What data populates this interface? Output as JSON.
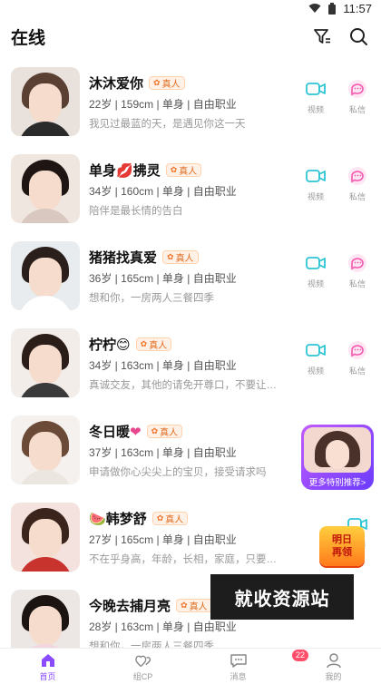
{
  "status": {
    "time": "11:57"
  },
  "header": {
    "title": "在线",
    "filter_icon": "filter-icon",
    "search_icon": "search-icon"
  },
  "ops": {
    "video_label": "视频",
    "chat_label": "私信"
  },
  "users": [
    {
      "name": "沐沐爱你",
      "badge": "真人",
      "meta": "22岁 | 159cm | 单身 | 自由职业",
      "sign": "我见过最蓝的天，是遇见你这一天",
      "emoji": ""
    },
    {
      "name": "单身",
      "emoji": "💋",
      "name2": "拂灵",
      "badge": "真人",
      "meta": "34岁 | 160cm | 单身 | 自由职业",
      "sign": "陪伴是最长情的告白"
    },
    {
      "name": "猪猪找真爱",
      "badge": "真人",
      "meta": "36岁 | 165cm | 单身 | 自由职业",
      "sign": "想和你，一房两人三餐四季",
      "emoji": ""
    },
    {
      "name": "柠柠",
      "emoji": "😊",
      "badge": "真人",
      "meta": "34岁 | 163cm | 单身 | 自由职业",
      "sign": "真诚交友，其他的请免开尊口，不要让你的..."
    },
    {
      "name": "冬日暖",
      "emoji": "❤",
      "badge": "真人",
      "meta": "37岁 | 163cm | 单身 | 自由职业",
      "sign": "申请做你心尖尖上的宝贝，接受请求吗"
    },
    {
      "name": "韩梦舒",
      "emoji": "🍉",
      "badge": "真人",
      "meta": "27岁 | 165cm | 单身 | 自由职业",
      "sign": "不在乎身高，年龄，长相，家庭，只要聊得..."
    },
    {
      "name": "今晚去捕月亮",
      "badge": "真人",
      "meta": "28岁 | 163cm | 单身 | 自由职业",
      "sign": "想和你，一房两人三餐四季",
      "emoji": ""
    }
  ],
  "promo": {
    "label": "更多特别推荐>"
  },
  "redeem": {
    "line1": "明日",
    "line2": "再领"
  },
  "watermark": "就收资源站",
  "tabbar": {
    "tabs": [
      {
        "label": "首页",
        "icon": "home-icon"
      },
      {
        "label": "组CP",
        "icon": "hearts-icon"
      },
      {
        "label": "消息",
        "icon": "message-icon",
        "count": "22"
      },
      {
        "label": "我的",
        "icon": "profile-icon"
      }
    ]
  },
  "colors": {
    "accent": "#8a4bff",
    "video": "#2ec5d6",
    "chat": "#f25ab0",
    "badge": "#e06b20"
  }
}
